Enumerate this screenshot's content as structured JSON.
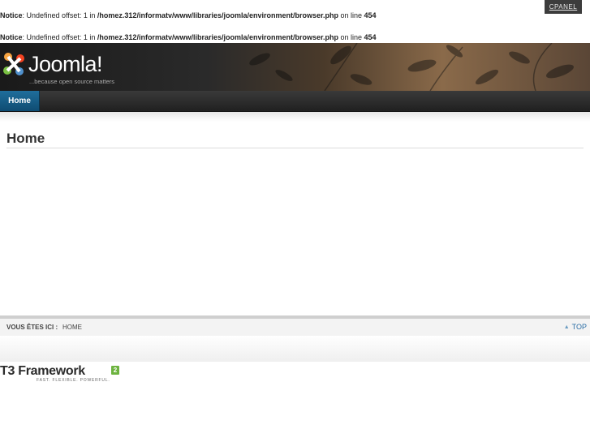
{
  "notices": [
    {
      "label": "Notice",
      "message": ": Undefined offset: 1 in ",
      "path": "/homez.312/informatv/www/libraries/joomla/environment/browser.php",
      "on_line": " on line ",
      "line": "454"
    },
    {
      "label": "Notice",
      "message": ": Undefined offset: 1 in ",
      "path": "/homez.312/informatv/www/libraries/joomla/environment/browser.php",
      "on_line": " on line ",
      "line": "454"
    }
  ],
  "cpanel_label": "CPANEL",
  "header": {
    "logo_text": "Joomla!",
    "logo_tagline": "...because open source matters"
  },
  "nav": {
    "items": [
      {
        "label": "Home"
      }
    ]
  },
  "main": {
    "title": "Home"
  },
  "breadcrumb": {
    "label": "VOUS ÊTES ICI :",
    "item": "HOME"
  },
  "top_link": "TOP",
  "footer_logo": {
    "text": "T3 Framework",
    "badge": "2",
    "tagline": "FAST. FLEXIBLE. POWERFUL."
  },
  "colors": {
    "nav_active": "#1f6e9c",
    "link": "#2a6ea6",
    "badge": "#6db33f"
  }
}
